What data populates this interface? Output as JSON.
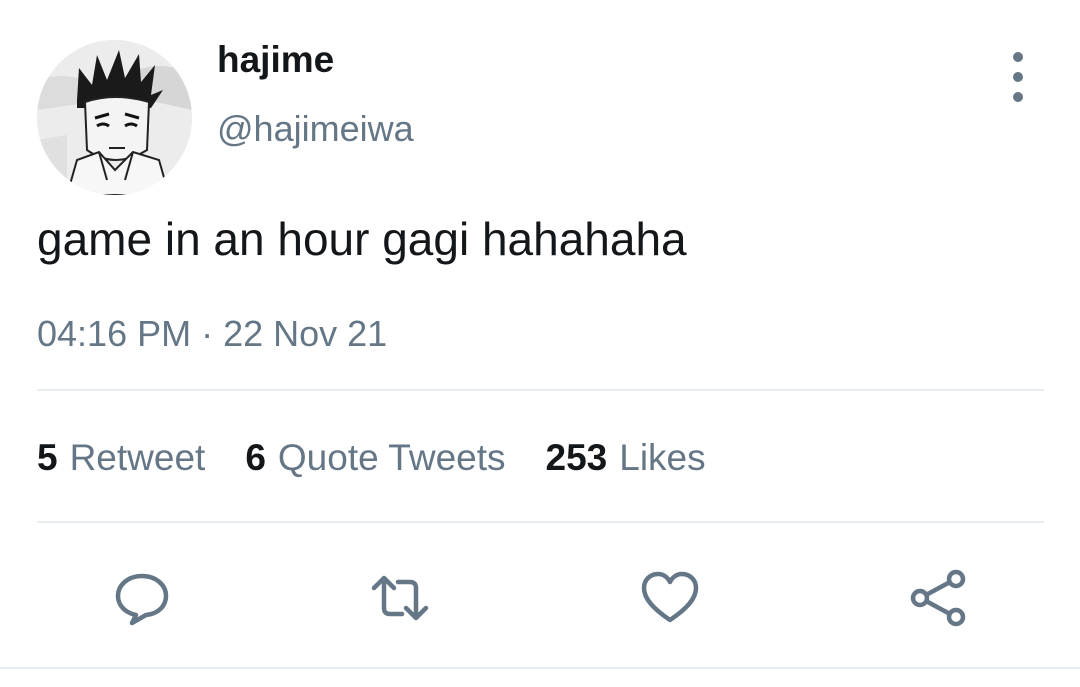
{
  "user": {
    "display_name": "hajime",
    "handle": "@hajimeiwa"
  },
  "tweet": {
    "text": "game in an hour gagi hahahaha",
    "timestamp": "04:16 PM · 22 Nov 21"
  },
  "stats": {
    "retweets": {
      "count": "5",
      "label": "Retweet"
    },
    "quotes": {
      "count": "6",
      "label": "Quote Tweets"
    },
    "likes": {
      "count": "253",
      "label": "Likes"
    }
  },
  "actions": {
    "reply_icon": "comment-icon",
    "retweet_icon": "retweet-icon",
    "like_icon": "heart-icon",
    "share_icon": "share-icon"
  },
  "colors": {
    "text_primary": "#14171a",
    "text_secondary": "#657786",
    "divider": "#e6ecf0"
  }
}
